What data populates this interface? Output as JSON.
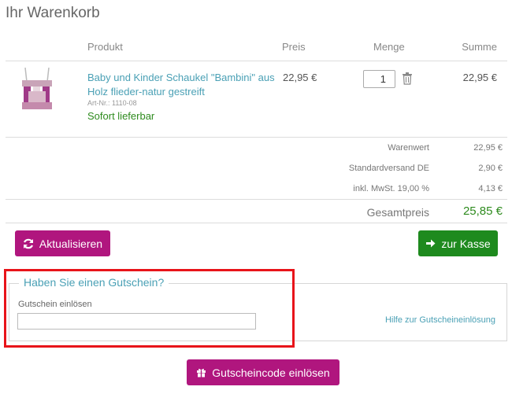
{
  "page": {
    "title": "Ihr Warenkorb"
  },
  "table": {
    "headers": {
      "product": "Produkt",
      "price": "Preis",
      "quantity": "Menge",
      "total": "Summe"
    }
  },
  "item": {
    "name": "Baby und Kinder Schaukel \"Bambini\" aus Holz flieder-natur gestreift",
    "art_nr": "Art-Nr.: 1110-08",
    "availability": "Sofort lieferbar",
    "price": "22,95 €",
    "quantity": "1",
    "total": "22,95 €"
  },
  "totals": {
    "rows": [
      {
        "label": "Warenwert",
        "value": "22,95 €"
      },
      {
        "label": "Standardversand DE",
        "value": "2,90 €"
      },
      {
        "label": "inkl. MwSt. 19,00 %",
        "value": "4,13 €"
      }
    ],
    "grand_label": "Gesamtpreis",
    "grand_value": "25,85 €"
  },
  "buttons": {
    "update": "Aktualisieren",
    "checkout": "zur Kasse",
    "redeem": "Gutscheincode einlösen"
  },
  "voucher": {
    "legend": "Haben Sie einen Gutschein?",
    "field_label": "Gutschein einlösen",
    "value": "",
    "help_link": "Hilfe zur Gutscheineinlösung"
  },
  "colors": {
    "brand": "#b0167e",
    "success": "#1e8a1e",
    "link": "#4aa0b5",
    "highlight": "#e8141a"
  },
  "icons": {
    "refresh": "refresh-icon",
    "arrow": "arrow-right-icon",
    "gift": "gift-icon",
    "trash": "trash-icon"
  }
}
